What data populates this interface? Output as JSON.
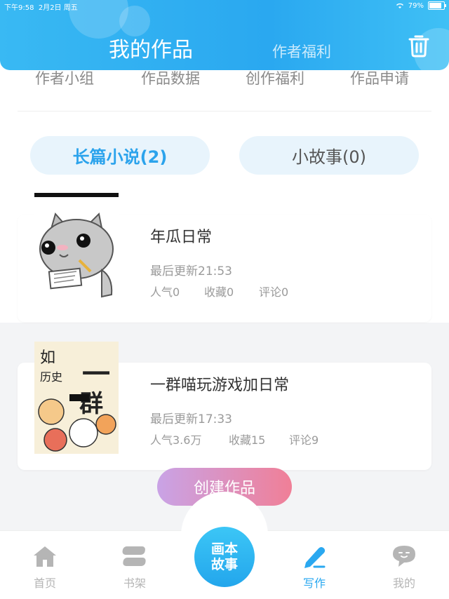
{
  "status_bar": {
    "time": "下午9:58",
    "date": "2月2日 周五",
    "battery": "79%"
  },
  "header": {
    "active_tab": "我的作品",
    "inactive_tab": "作者福利"
  },
  "sub_nav": [
    "作者小组",
    "作品数据",
    "创作福利",
    "作品申请"
  ],
  "categories": {
    "long_novel": "长篇小说(2)",
    "short_story": "小故事(0)"
  },
  "works": [
    {
      "title": "年瓜日常",
      "updated": "最后更新21:53",
      "popularity": "人气0",
      "favorites": "收藏0",
      "comments": "评论0"
    },
    {
      "title": "一群喵玩游戏加日常",
      "updated": "最后更新17:33",
      "popularity": "人气3.6万",
      "favorites": "收藏15",
      "comments": "评论9"
    }
  ],
  "cover2_text": "一群喵 如果历史是",
  "create_button": "创建作品",
  "tab_bar": {
    "home": "首页",
    "bookshelf": "书架",
    "center_line1": "画本",
    "center_line2": "故事",
    "write": "写作",
    "mine": "我的"
  },
  "colors": {
    "primary": "#2aa8f0",
    "create_start": "#c9a3e6",
    "create_end": "#f07f97"
  }
}
